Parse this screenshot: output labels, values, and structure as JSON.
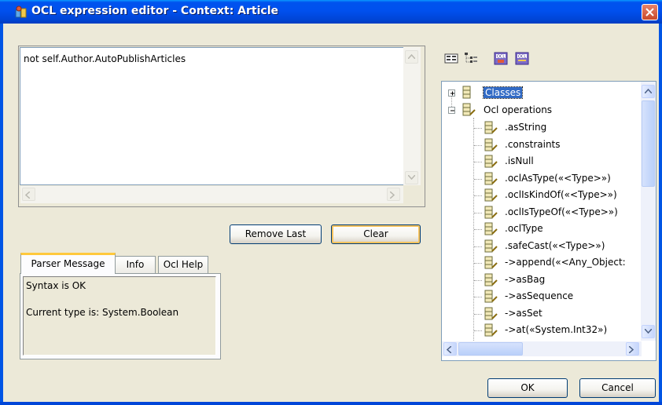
{
  "window": {
    "title": "OCL expression editor - Context: Article"
  },
  "expression": {
    "text": "not self.Author.AutoPublishArticles"
  },
  "buttons": {
    "remove_last": "Remove Last",
    "clear": "Clear",
    "ok": "OK",
    "cancel": "Cancel"
  },
  "tabs": [
    {
      "label": "Parser Message",
      "active": true
    },
    {
      "label": "Info",
      "active": false
    },
    {
      "label": "Ocl Help",
      "active": false
    }
  ],
  "parser": {
    "line1": "Syntax is OK",
    "line2": "Current type is: System.Boolean"
  },
  "toolbar": {
    "icons": [
      "show-description-icon",
      "tree-view-icon",
      "ocl-expression-icon",
      "ocl-operation-icon"
    ]
  },
  "tree": {
    "roots": [
      {
        "label": "Classes",
        "expanded": false,
        "selected": true,
        "icon": "class-icon"
      },
      {
        "label": "Ocl operations",
        "expanded": true,
        "selected": false,
        "icon": "operation-icon"
      }
    ],
    "operations": [
      ".asString",
      ".constraints",
      ".isNull",
      ".oclAsType(«<Type>»)",
      ".oclIsKindOf(«<Type>»)",
      ".oclIsTypeOf(«<Type>»)",
      ".oclType",
      ".safeCast(«<Type>»)",
      "->append(«<Any_Object:",
      "->asBag",
      "->asSequence",
      "->asSet",
      "->at(«System.Int32»)"
    ]
  }
}
